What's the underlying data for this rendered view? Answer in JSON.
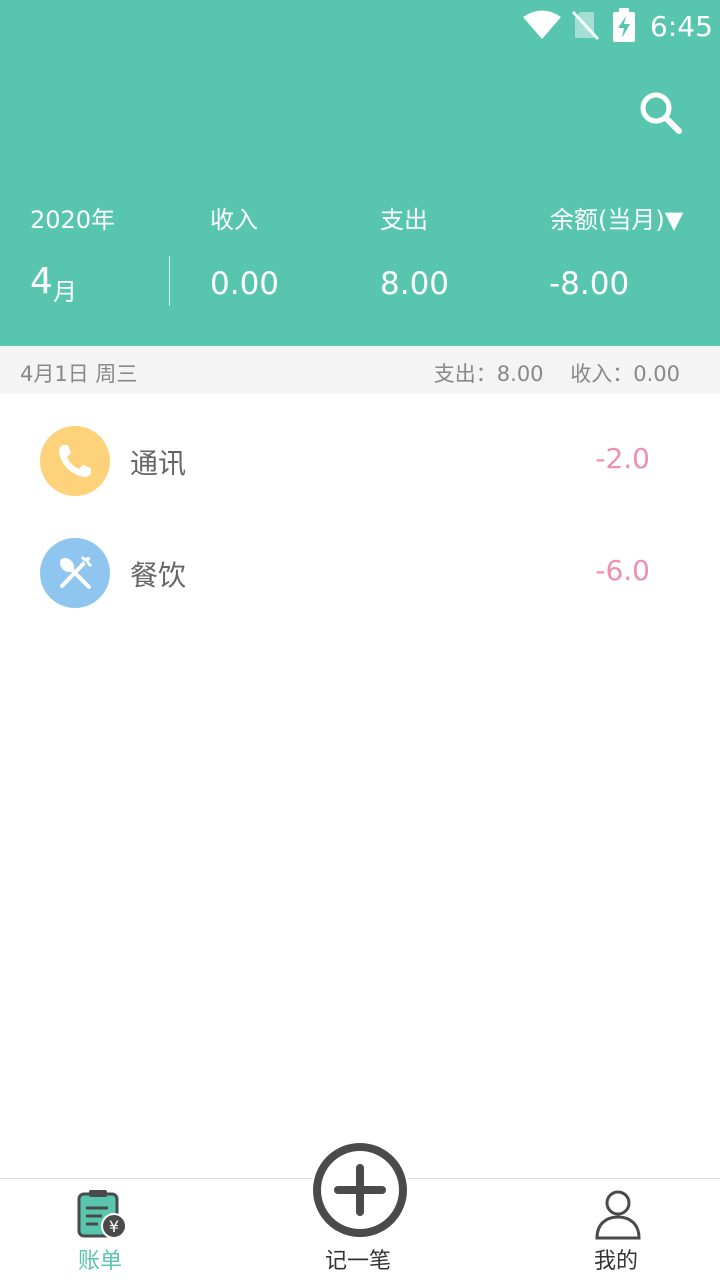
{
  "status_bar": {
    "time": "6:45"
  },
  "summary": {
    "year": "2020年",
    "month_num": "4",
    "month_unit": "月",
    "income_label": "收入",
    "income_value": "0.00",
    "expense_label": "支出",
    "expense_value": "8.00",
    "balance_label": "余额(当月)▼",
    "balance_value": "-8.00"
  },
  "day_group": {
    "date": "4月1日 周三",
    "expense_total": "支出：8.00",
    "income_total": "收入：0.00"
  },
  "records": [
    {
      "category": "通讯",
      "amount": "-2.0",
      "icon": "phone-icon",
      "color": "#fdd27a"
    },
    {
      "category": "餐饮",
      "amount": "-6.0",
      "icon": "fork-spoon-icon",
      "color": "#8fc6f0"
    }
  ],
  "tabs": {
    "bills": "账单",
    "add": "记一笔",
    "mine": "我的"
  },
  "colors": {
    "primary": "#58c6af",
    "expense_amount": "#f08fb1",
    "tab_inactive": "#333333"
  }
}
